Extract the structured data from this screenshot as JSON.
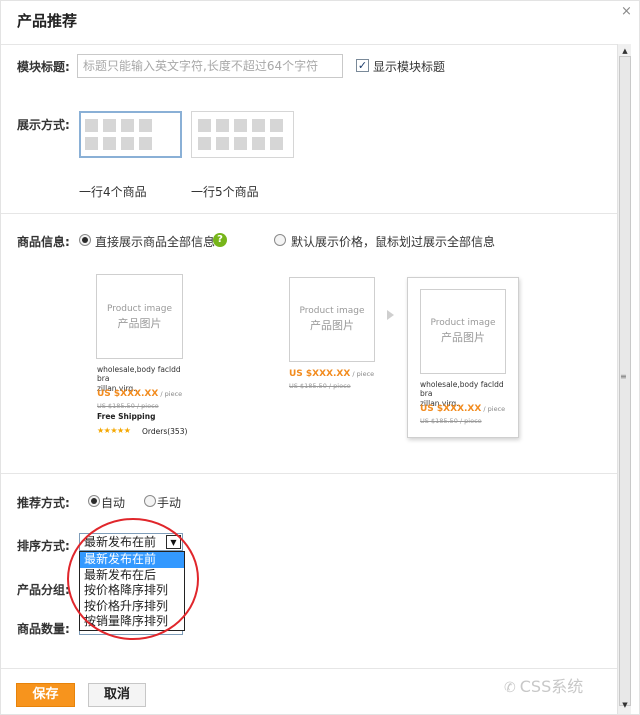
{
  "dialog": {
    "title": "产品推荐",
    "close_glyph": "×"
  },
  "module_title": {
    "label": "模块标题:",
    "placeholder": "标题只能输入英文字符,长度不超过64个字符",
    "show_title_checked": true,
    "show_title_label": "显示模块标题"
  },
  "display_mode": {
    "label": "展示方式:",
    "options": [
      {
        "caption": "一行4个商品",
        "selected": true
      },
      {
        "caption": "一行5个商品",
        "selected": false
      }
    ]
  },
  "product_info": {
    "label": "商品信息:",
    "options": [
      {
        "label": "直接展示商品全部信息",
        "selected": true
      },
      {
        "label": "默认展示价格，鼠标划过展示全部信息",
        "selected": false
      }
    ],
    "help_glyph": "?"
  },
  "preview": {
    "image_label_en": "Product image",
    "image_label_cn": "产品图片",
    "product_name_line1": "wholesale,body facldd bra",
    "product_name_line2": "zillan virg...",
    "product_name2_line1": "wholesale,body facldd bra",
    "product_name2_line2": "zillan virg...",
    "price": "US $XXX.XX",
    "price_unit": " / piece",
    "old_price": "US $185.50 / piece",
    "free_shipping": "Free Shipping",
    "stars": "★★★★★",
    "orders": "Orders(353)"
  },
  "recommend_mode": {
    "label": "推荐方式:",
    "options": [
      {
        "label": "自动",
        "selected": true
      },
      {
        "label": "手动",
        "selected": false
      }
    ]
  },
  "sort_mode": {
    "label": "排序方式:",
    "selected": "最新发布在前",
    "dropdown_glyph": "▼",
    "options": [
      "最新发布在前",
      "最新发布在后",
      "按价格降序排列",
      "按价格升序排列",
      "按销量降序排列"
    ],
    "highlighted_index": 0
  },
  "product_group": {
    "label": "产品分组:"
  },
  "product_count": {
    "label": "商品数量:"
  },
  "buttons": {
    "save": "保存",
    "cancel": "取消"
  },
  "watermark": {
    "icon": "✆",
    "text": "CSS系统"
  },
  "scrollbar": {
    "up": "▲",
    "down": "▼",
    "grip": "≡"
  },
  "colors": {
    "accent_orange": "#f7941d",
    "price_orange": "#f28b1e",
    "highlight_blue": "#3399ff",
    "annotation_red": "#e0262b",
    "help_green": "#77b51a"
  }
}
